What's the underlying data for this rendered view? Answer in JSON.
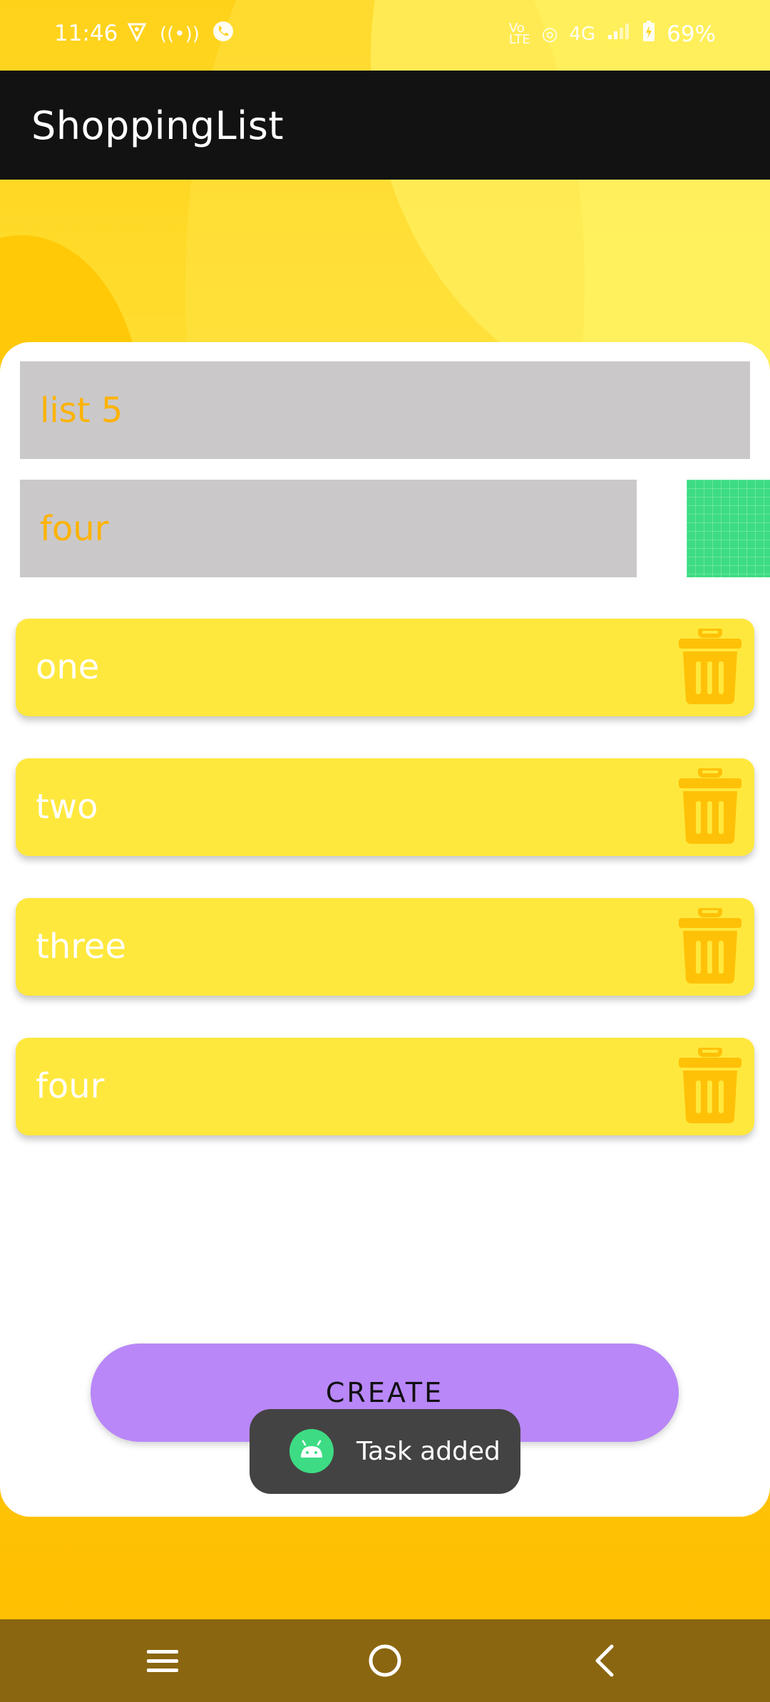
{
  "status_bar": {
    "time": "11:46",
    "left_icons": [
      "location-shield-icon",
      "hotspot-icon",
      "call-icon"
    ],
    "right_icons": [
      "volte-icon",
      "hotspot-signal-icon",
      "network-type-icon",
      "signal-icon",
      "charging-icon"
    ],
    "network_type": "4G",
    "battery": "69%"
  },
  "toolbar": {
    "title": "ShoppingList"
  },
  "form": {
    "list_name_value": "list 5",
    "item_name_value": "four",
    "add_tile_color": "#3ddc84"
  },
  "items": [
    {
      "label": "one",
      "delete_icon": "trash-icon"
    },
    {
      "label": "two",
      "delete_icon": "trash-icon"
    },
    {
      "label": "three",
      "delete_icon": "trash-icon"
    },
    {
      "label": "four",
      "delete_icon": "trash-icon"
    }
  ],
  "create_button": {
    "label": "CREATE",
    "color": "#b987f8"
  },
  "toast": {
    "message": "Task added",
    "icon": "android-icon"
  },
  "nav_bar": {
    "buttons": [
      "recents-icon",
      "home-icon",
      "back-icon"
    ]
  },
  "colors": {
    "item_bg": "#ffe83d",
    "accent_text": "#ffb300",
    "trash": "#ffc107",
    "toolbar": "#121212",
    "field_bg": "#cac8c9"
  }
}
